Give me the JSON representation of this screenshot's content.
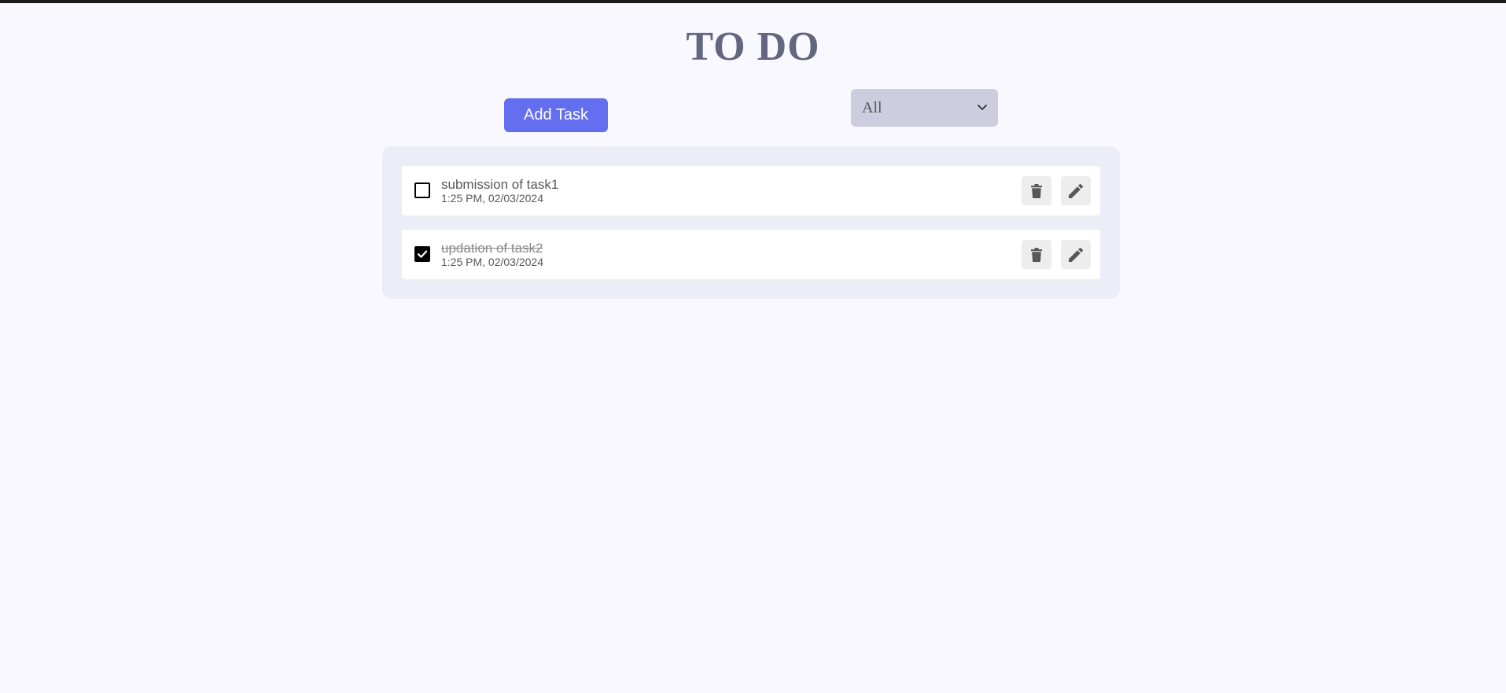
{
  "header": {
    "title": "TO DO"
  },
  "toolbar": {
    "add_label": "Add Task",
    "filter": {
      "selected": "All",
      "icon": "chevron-down-icon"
    }
  },
  "tasks": [
    {
      "title": "submission of task1",
      "time": "1:25 PM, 02/03/2024",
      "completed": false
    },
    {
      "title": "updation of task2",
      "time": "1:25 PM, 02/03/2024",
      "completed": true
    }
  ],
  "icons": {
    "delete": "trash-icon",
    "edit": "pencil-icon",
    "check": "checkmark-icon"
  },
  "colors": {
    "background": "#f8f8fe",
    "title": "#646681",
    "accent": "#646ff0",
    "filter_bg": "#cccdde",
    "panel_bg": "#ecedf6",
    "icon_button_bg": "#ededed",
    "text": "#585858"
  }
}
